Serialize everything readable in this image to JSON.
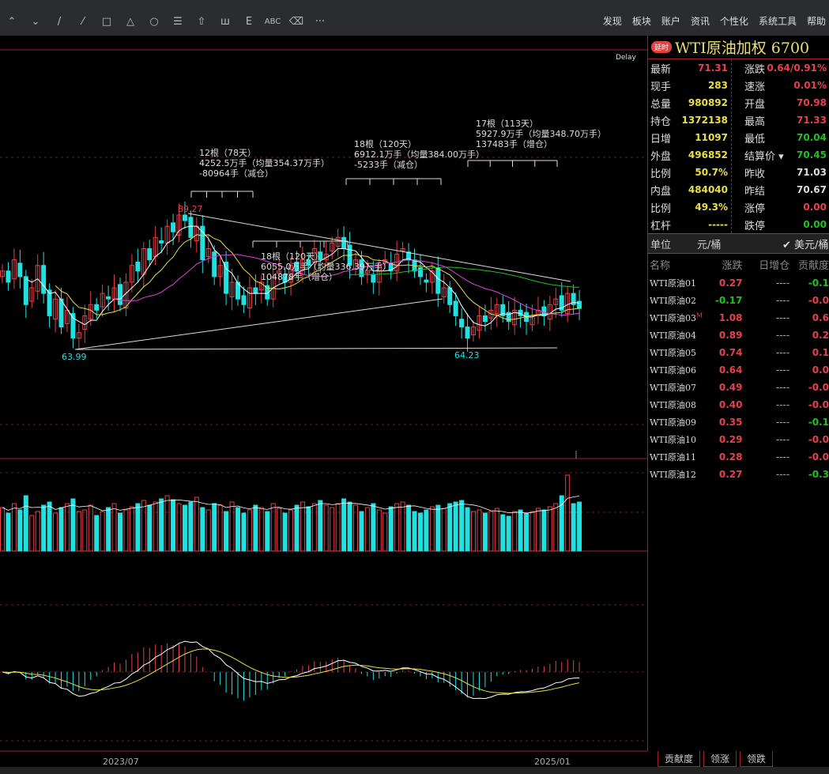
{
  "toolbar": {
    "tools": [
      "up-double-chevron",
      "down-double-chevron",
      "line",
      "segment",
      "rectangle",
      "triangle",
      "ellipse",
      "text-block",
      "arrow-up",
      "bars",
      "fib",
      "ABC",
      "eraser",
      "more"
    ],
    "tool_glyphs": [
      "⌃",
      "⌄",
      "/",
      "⁄",
      "□",
      "△",
      "○",
      "☰",
      "⇧",
      "ш",
      "E",
      "ABC",
      "⌫",
      "···"
    ],
    "menu": [
      "发现",
      "板块",
      "账户",
      "资讯",
      "个性化",
      "系统工具",
      "帮助"
    ]
  },
  "chart": {
    "delay_label": "Delay",
    "high_label": "89.27",
    "low_label": "63.99",
    "low2_label": "64.23",
    "annotations": [
      {
        "lines": [
          "12根（78天）",
          "4252.5万手（均量354.37万手）",
          "-80964手（减仓）"
        ]
      },
      {
        "lines": [
          "18根（120天）",
          "6912.1万手（均量384.00万手）",
          "-5233手（减仓）"
        ]
      },
      {
        "lines": [
          "17根（113天）",
          "5927.9万手（均量348.70万手）",
          "137483手（增仓）"
        ]
      },
      {
        "lines": [
          "18根（120天）",
          "6055.0万手（均量336.39万手）",
          "104878手（增仓）"
        ]
      }
    ],
    "x_labels": [
      "2023/07",
      "2025/01"
    ],
    "colors": {
      "up": "#e8404a",
      "down": "#20e0e0",
      "grid": "#a0202a",
      "ma5": "#ffffff",
      "ma10": "#e8e040",
      "ma20": "#e040e0",
      "ma60": "#20c020"
    }
  },
  "chart_data": {
    "type": "candlestick",
    "closes": [
      78,
      76,
      80,
      77,
      72,
      75,
      79,
      74,
      70,
      73,
      68,
      71,
      66,
      67,
      70,
      72,
      71,
      74,
      73,
      75,
      72,
      76,
      79,
      78,
      82,
      80,
      84,
      83,
      86,
      85,
      88,
      87,
      84,
      86,
      80,
      82,
      77,
      79,
      74,
      76,
      73,
      72,
      75,
      74,
      76,
      73,
      77,
      78,
      76,
      79,
      78,
      80,
      79,
      82,
      80,
      81,
      83,
      84,
      82,
      79,
      80,
      77,
      78,
      76,
      79,
      80,
      78,
      81,
      82,
      80,
      78,
      77,
      76,
      78,
      74,
      75,
      72,
      70,
      68,
      66,
      68,
      70,
      69,
      71,
      72,
      70,
      69,
      71,
      70,
      69,
      70,
      71,
      70,
      72,
      73,
      71,
      74,
      72,
      71.31
    ],
    "volumes": [
      55,
      48,
      60,
      52,
      70,
      45,
      50,
      58,
      62,
      48,
      55,
      60,
      66,
      50,
      52,
      58,
      45,
      50,
      55,
      60,
      48,
      52,
      56,
      60,
      64,
      58,
      62,
      66,
      70,
      65,
      60,
      58,
      62,
      68,
      55,
      52,
      60,
      58,
      50,
      62,
      55,
      48,
      52,
      58,
      55,
      50,
      60,
      54,
      48,
      52,
      58,
      62,
      56,
      60,
      64,
      58,
      55,
      60,
      66,
      62,
      58,
      50,
      55,
      60,
      52,
      48,
      56,
      60,
      62,
      58,
      50,
      48,
      52,
      56,
      58,
      54,
      60,
      62,
      64,
      55,
      50,
      52,
      48,
      50,
      54,
      46,
      44,
      50,
      52,
      48,
      50,
      54,
      52,
      56,
      60,
      70,
      96,
      60,
      62
    ],
    "high": 89.27,
    "low": 63.99
  },
  "quote": {
    "badge": "延时",
    "title": "WTI原油加权  6700",
    "left": [
      [
        "最新",
        "71.31",
        "r"
      ],
      [
        "现手",
        "283",
        "y"
      ],
      [
        "总量",
        "980892",
        "y"
      ],
      [
        "持仓",
        "1372138",
        "y"
      ],
      [
        "日增",
        "11097",
        "y"
      ],
      [
        "外盘",
        "496852",
        "y"
      ],
      [
        "比例",
        "50.7%",
        "y"
      ],
      [
        "内盘",
        "484040",
        "y"
      ],
      [
        "比例",
        "49.3%",
        "y"
      ],
      [
        "杠杆",
        "-----",
        "y"
      ]
    ],
    "right": [
      [
        "涨跌",
        "0.64/0.91%",
        "r"
      ],
      [
        "速涨",
        "0.01%",
        "r"
      ],
      [
        "开盘",
        "70.98",
        "r"
      ],
      [
        "最高",
        "71.33",
        "r"
      ],
      [
        "最低",
        "70.04",
        "g"
      ],
      [
        "结算价 ▾",
        "70.45",
        "g"
      ],
      [
        "昨收",
        "71.03",
        "w"
      ],
      [
        "昨结",
        "70.67",
        "w"
      ],
      [
        "涨停",
        "0.00",
        "r"
      ],
      [
        "跌停",
        "0.00",
        "g"
      ]
    ],
    "unit_label": "单位",
    "unit_a": "元/桶",
    "unit_b": "✔ 美元/桶"
  },
  "list": {
    "headers": [
      "名称",
      "涨跌",
      "日增仓",
      "贡献度"
    ],
    "rows": [
      [
        "WTI原油01",
        "0.27",
        "----",
        "-0.1"
      ],
      [
        "WTI原油02",
        "-0.17",
        "----",
        "-0.0"
      ],
      [
        "WTI原油03",
        "1.08",
        "----",
        "0.6"
      ],
      [
        "WTI原油04",
        "0.89",
        "----",
        "0.2"
      ],
      [
        "WTI原油05",
        "0.74",
        "----",
        "0.1"
      ],
      [
        "WTI原油06",
        "0.64",
        "----",
        "0.0"
      ],
      [
        "WTI原油07",
        "0.49",
        "----",
        "-0.0"
      ],
      [
        "WTI原油08",
        "0.40",
        "----",
        "-0.0"
      ],
      [
        "WTI原油09",
        "0.35",
        "----",
        "-0.1"
      ],
      [
        "WTI原油10",
        "0.29",
        "----",
        "-0.0"
      ],
      [
        "WTI原油11",
        "0.28",
        "----",
        "-0.0"
      ],
      [
        "WTI原油12",
        "0.27",
        "----",
        "-0.3"
      ]
    ],
    "main_marker": "M"
  },
  "tabs": [
    "贡献度",
    "领涨",
    "领跌"
  ]
}
